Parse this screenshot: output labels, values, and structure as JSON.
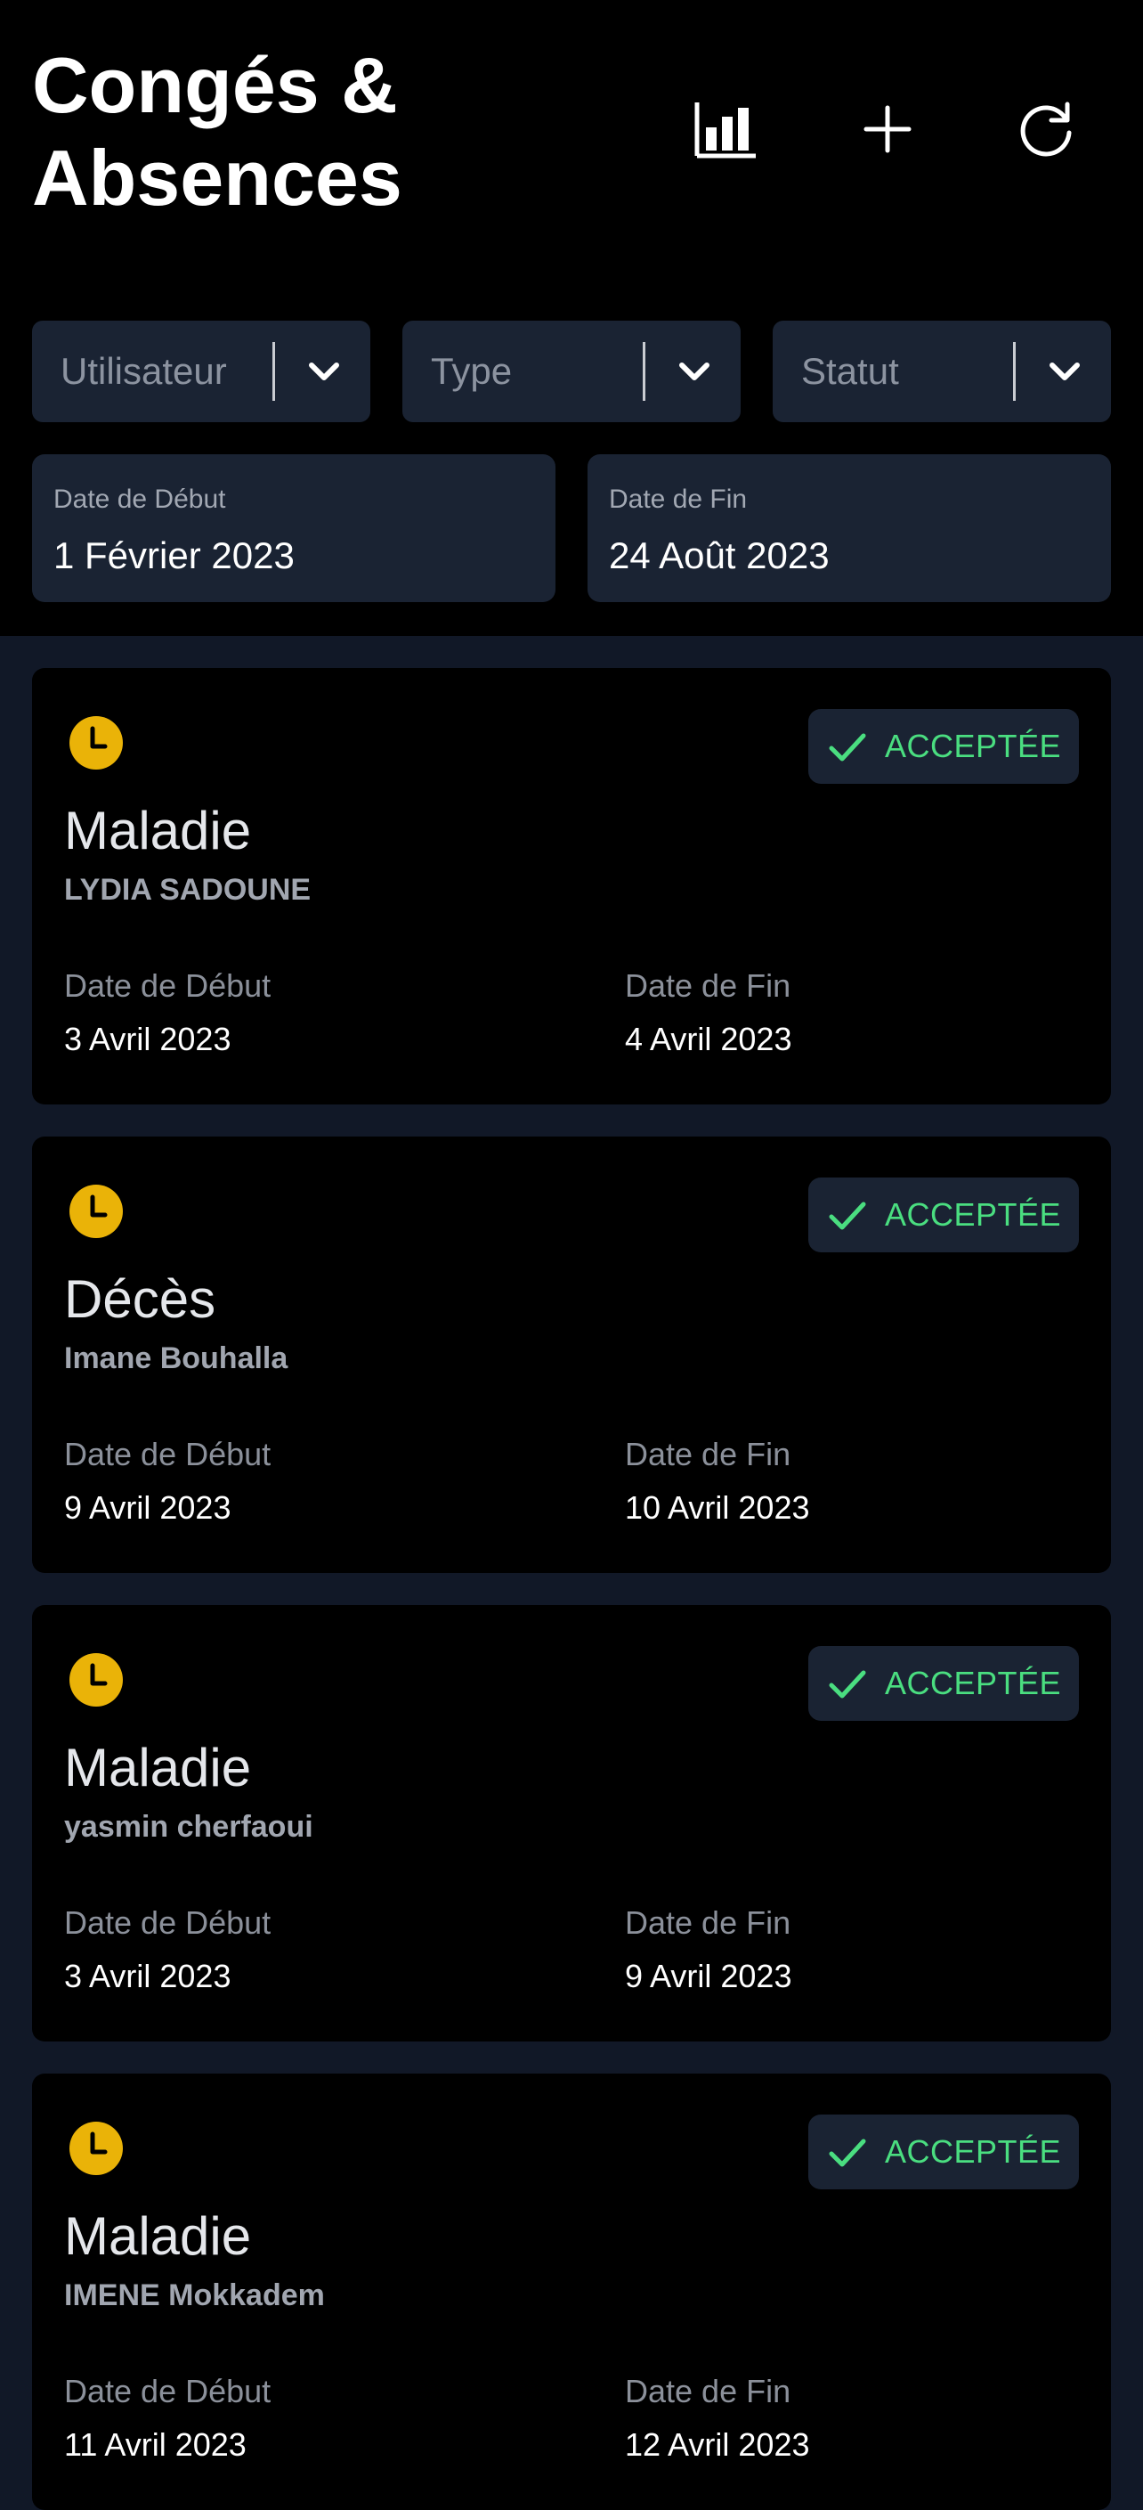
{
  "header": {
    "title_line1": "Congés &",
    "title_line2": "Absences",
    "stats_icon": "bar-chart-icon",
    "add_icon": "plus-icon",
    "refresh_icon": "refresh-icon"
  },
  "filters": [
    {
      "label": "Utilisateur"
    },
    {
      "label": "Type"
    },
    {
      "label": "Statut"
    }
  ],
  "date_range": {
    "start_label": "Date de Début",
    "start_value": "1 Février 2023",
    "end_label": "Date de Fin",
    "end_value": "24 Août 2023"
  },
  "colors": {
    "accent_clock": "#eab308",
    "status_green": "#4ade80",
    "panel": "#1a2333"
  },
  "requests": [
    {
      "status": "ACCEPTÉE",
      "type": "Maladie",
      "person": "LYDIA SADOUNE",
      "start_label": "Date de Début",
      "start": "3 Avril 2023",
      "end_label": "Date de Fin",
      "end": "4 Avril 2023"
    },
    {
      "status": "ACCEPTÉE",
      "type": "Décès",
      "person": "Imane Bouhalla",
      "start_label": "Date de Début",
      "start": "9 Avril 2023",
      "end_label": "Date de Fin",
      "end": "10 Avril 2023"
    },
    {
      "status": "ACCEPTÉE",
      "type": "Maladie",
      "person": "yasmin cherfaoui",
      "start_label": "Date de Début",
      "start": "3 Avril 2023",
      "end_label": "Date de Fin",
      "end": "9 Avril 2023"
    },
    {
      "status": "ACCEPTÉE",
      "type": "Maladie",
      "person": "IMENE Mokkadem",
      "start_label": "Date de Début",
      "start": "11 Avril 2023",
      "end_label": "Date de Fin",
      "end": "12 Avril 2023"
    }
  ]
}
